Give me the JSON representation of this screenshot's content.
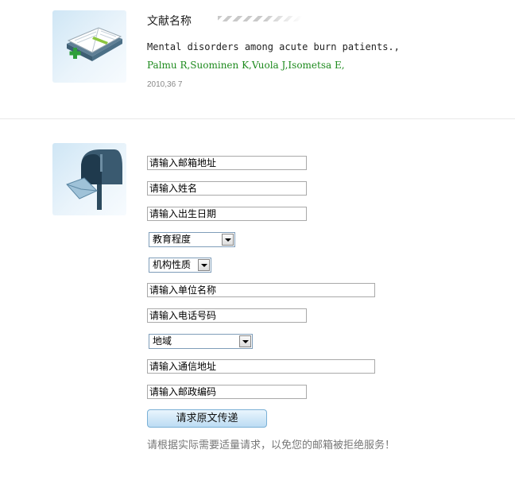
{
  "article": {
    "title_label": "文献名称",
    "paper_title": "Mental disorders among acute burn patients.,",
    "authors": "Palmu R,Suominen K,Vuola J,Isometsa E,",
    "meta": "2010,36 7"
  },
  "form": {
    "email": "请输入邮箱地址",
    "name": "请输入姓名",
    "birthdate": "请输入出生日期",
    "education": "教育程度",
    "org_type": "机构性质",
    "company": "请输入单位名称",
    "phone": "请输入电话号码",
    "region": "地域",
    "address": "请输入通信地址",
    "postcode": "请输入邮政编码",
    "submit_label": "请求原文传递",
    "notice": "请根据实际需要适量请求，以免您的邮箱被拒绝服务！"
  },
  "icons": [
    "book-icon",
    "mailbox-icon",
    "chevron-down-icon"
  ]
}
